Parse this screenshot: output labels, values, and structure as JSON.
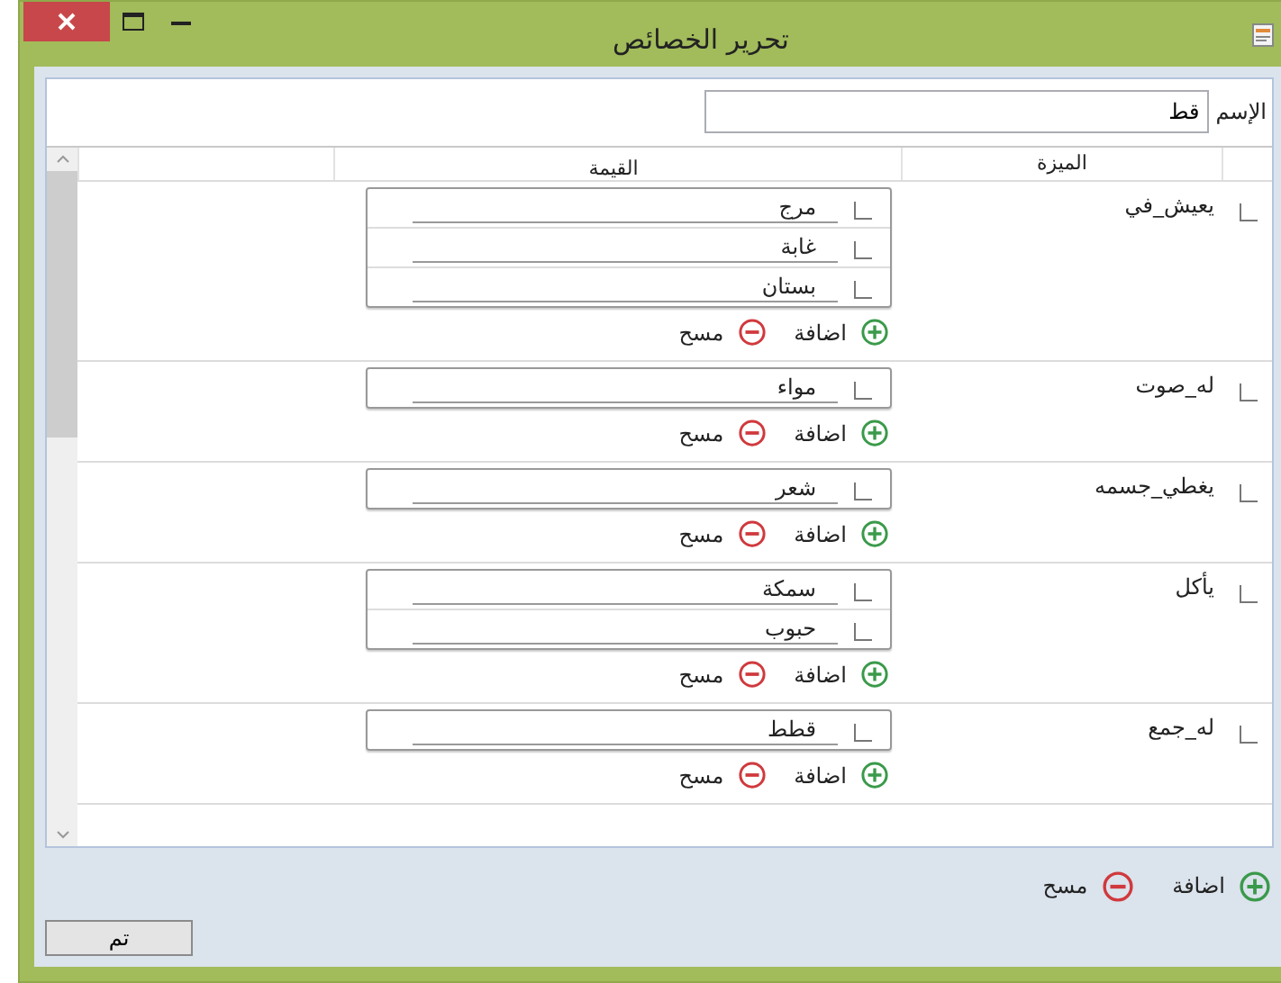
{
  "window": {
    "title": "تحرير الخصائص"
  },
  "name_field": {
    "label": "الإسم",
    "value": "قط"
  },
  "table": {
    "columns": [
      "الميزة",
      "القيمة"
    ],
    "rows": [
      {
        "feature": "يعيش_في",
        "checked": false,
        "values": [
          {
            "text": "مرج",
            "checked": false
          },
          {
            "text": "غابة",
            "checked": false
          },
          {
            "text": "بستان",
            "checked": false
          }
        ],
        "add": "اضافة",
        "remove": "مسح"
      },
      {
        "feature": "له_صوت",
        "checked": false,
        "values": [
          {
            "text": "مواء",
            "checked": false
          }
        ],
        "add": "اضافة",
        "remove": "مسح"
      },
      {
        "feature": "يغطي_جسمه",
        "checked": false,
        "values": [
          {
            "text": "شعر",
            "checked": false
          }
        ],
        "add": "اضافة",
        "remove": "مسح"
      },
      {
        "feature": "يأكل",
        "checked": false,
        "values": [
          {
            "text": "سمكة",
            "checked": false
          },
          {
            "text": "حبوب",
            "checked": false
          }
        ],
        "add": "اضافة",
        "remove": "مسح"
      },
      {
        "feature": "له_جمع",
        "checked": false,
        "values": [
          {
            "text": "قطط",
            "checked": false
          }
        ],
        "add": "اضافة",
        "remove": "مسح"
      }
    ]
  },
  "footer": {
    "add": "اضافة",
    "remove": "مسح",
    "done": "تم"
  }
}
